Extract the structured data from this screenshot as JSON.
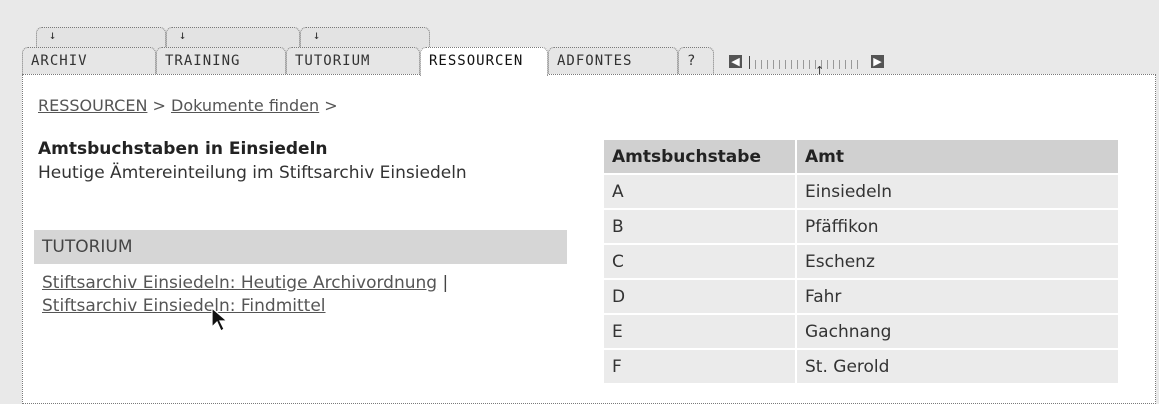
{
  "top_tabs": [
    {
      "arrow": "↓"
    },
    {
      "arrow": "↓"
    },
    {
      "arrow": "↓"
    }
  ],
  "tabs": [
    {
      "label": "ARCHIV"
    },
    {
      "label": "TRAINING"
    },
    {
      "label": "TUTORIUM"
    },
    {
      "label": "RESSOURCEN",
      "active": true
    },
    {
      "label": "ADFONTES"
    },
    {
      "label": "?"
    }
  ],
  "scroller": {
    "left": "◀",
    "right": "▶",
    "marker": "↑"
  },
  "breadcrumb": {
    "item1": "RESSOURCEN",
    "sep1": ">",
    "item2": "Dokumente finden",
    "sep2": ">"
  },
  "page": {
    "title": "Amtsbuchstaben in Einsiedeln",
    "subtitle": "Heutige Ämtereinteilung im Stiftsarchiv Einsiedeln"
  },
  "tutorium": {
    "heading": "TUTORIUM",
    "link1": "Stiftsarchiv Einsiedeln: Heutige Archivordnung",
    "separator": "|",
    "link2": "Stiftsarchiv Einsiedeln: Findmittel"
  },
  "table": {
    "headers": [
      "Amtsbuchstabe",
      "Amt"
    ],
    "rows": [
      [
        "A",
        "Einsiedeln"
      ],
      [
        "B",
        "Pfäffikon"
      ],
      [
        "C",
        "Eschenz"
      ],
      [
        "D",
        "Fahr"
      ],
      [
        "E",
        "Gachnang"
      ],
      [
        "F",
        "St. Gerold"
      ]
    ]
  }
}
